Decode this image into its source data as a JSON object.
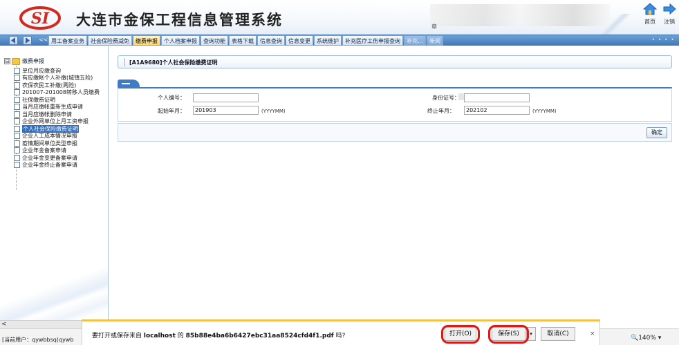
{
  "header": {
    "title": "大连市金保工程信息管理系统",
    "blurred_char": "章",
    "home_label": "首页",
    "logout_label": "注销"
  },
  "nav": {
    "collapse": "<<|",
    "tabs": [
      "用工备案业务",
      "社会保险费减免",
      "缴费申报",
      "个人档案申报",
      "查询功能",
      "表格下载",
      "信息查询",
      "信息变更",
      "系统维护",
      "补充医疗工伤申报查询",
      "补充…",
      "新闻"
    ],
    "active_index": 2,
    "dots": "• • • •"
  },
  "sidebar": {
    "root_toggle": "⊟",
    "root_label": "缴费申报",
    "items": [
      "单位月应缴查询",
      "有应缴帐个人补缴(城镇五险)",
      "农保农民工补缴(两险)",
      "201007-201008转移人员缴费",
      "社保缴费证明",
      "当月应缴帐重新生成申请",
      "当月应缴帐删除申请",
      "企业外网单位上月工资申报",
      "个人社会保险缴费证明",
      "企业人工成本情况申报",
      "疫情期间单位类型申报",
      "企业年金备案申请",
      "企业年金变更备案申请",
      "企业年金终止备案申请"
    ],
    "selected_index": 8,
    "scroll_left": "<"
  },
  "status": {
    "current_user": "[当前用户：qywbbsq(qywb",
    "zoom": "🔍140% ▾"
  },
  "main": {
    "page_title": "[A1A9680]个人社会保险缴费证明",
    "form": {
      "personal_no_label": "个人编号：",
      "id_no_label": "身份证号：",
      "start_month_label": "起始年月：",
      "start_month_value": "201903",
      "end_month_label": "终止年月：",
      "end_month_value": "202102",
      "format_hint": "(YYYYMM)"
    },
    "confirm_label": "确定"
  },
  "download": {
    "prefix": "要打开或保存来自 ",
    "host": "localhost",
    "middle": " 的 ",
    "file": "85b88e4ba6b6427ebc31aa8524cfd4f1.pdf",
    "suffix": " 吗?",
    "open_label": "打开(O)",
    "save_label": "保存(S)",
    "save_dropdown": "▾",
    "cancel_label": "取消(C)",
    "close": "×"
  },
  "colors": {
    "nav_blue": "#3f78b8",
    "highlight_red": "#d81a1a",
    "selected_blue": "#2f6ec0"
  }
}
